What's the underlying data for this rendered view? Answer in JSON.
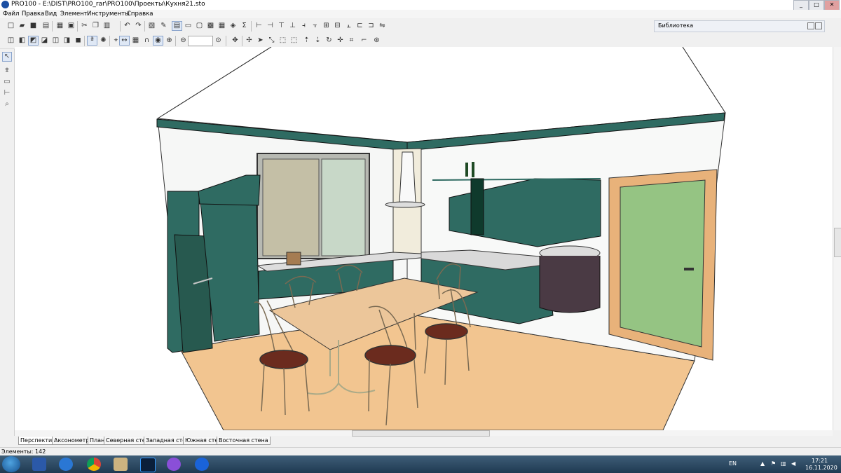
{
  "window": {
    "title": "PRO100 - E:\\DIST\\PRO100_rar\\PRO100\\Проекты\\Кухня21.sto",
    "min": "_",
    "max": "□",
    "close": "✕"
  },
  "menu": [
    "Файл",
    "Правка",
    "Вид",
    "Элемент",
    "Инструменты",
    "Справка"
  ],
  "library": {
    "title": "Библиотека"
  },
  "view_tabs": [
    "Перспектива",
    "Аксонометрия",
    "План",
    "Северная стена",
    "Западная стена",
    "Южная стена",
    "Восточная стена"
  ],
  "status": {
    "elements": "Элементы: 142"
  },
  "tray": {
    "lang": "EN",
    "time": "17:21",
    "date": "16.11.2020"
  },
  "colors": {
    "cabinet": "#2f6b62",
    "cabinet_dark": "#1f4f48",
    "floor": "#f2c590",
    "table_top": "#ecc69a",
    "seat": "#6b2b1e",
    "door_glass": "#95c483",
    "door_frame": "#e8b27a"
  },
  "icons": {
    "toolbar1": [
      "new-file-icon",
      "open-folder-icon",
      "save-icon",
      "save-as-icon",
      "print-icon",
      "print-preview-icon",
      "cut-icon",
      "copy-icon",
      "paste-icon",
      "undo-icon",
      "redo-icon",
      "properties-icon",
      "edit-icon",
      "window-icon",
      "layout-icon",
      "monitor-icon",
      "materials-icon",
      "grid-icon",
      "sigma-icon",
      "align-left-icon",
      "align-center-icon",
      "align-right-icon",
      "distribute-icon",
      "rotate-icon",
      "mirror-icon",
      "group-icon",
      "link-icon"
    ],
    "toolbar2": [
      "render-flat-icon",
      "render-shaded-icon",
      "render-texture-icon",
      "render-color-icon",
      "render-wire-icon",
      "render-box-icon",
      "text-label-icon",
      "light-bulb-icon",
      "view-3d-icon",
      "dimension-icon",
      "grid-toggle-icon",
      "magnet-icon",
      "scene-icon",
      "target-icon",
      "zoom-out-icon",
      "zoom-in-icon",
      "move-icon",
      "pan-icon",
      "select-area-icon",
      "scale-icon",
      "resize-icon",
      "rotate-x-icon",
      "rotate-y-icon",
      "orbit-icon",
      "flip-icon",
      "corner-icon",
      "snap-icon"
    ],
    "leftbar": [
      "select-arrow-icon",
      "hatch-icon",
      "rect-icon",
      "measure-icon",
      "zoom-icon"
    ]
  }
}
